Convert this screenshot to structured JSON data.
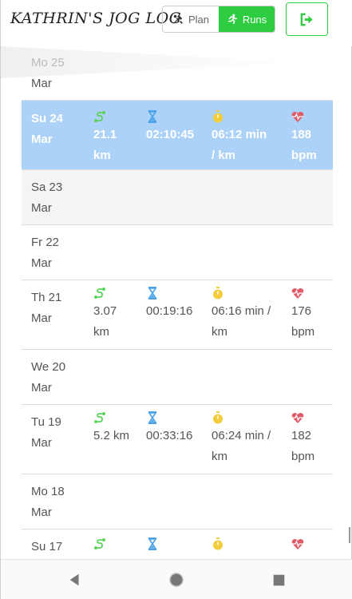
{
  "app": {
    "title": "KATHRIN'S JOG LOG"
  },
  "header": {
    "plan_label": "Plan",
    "runs_label": "Runs",
    "active_tab": "Runs"
  },
  "icons": {
    "distance": "route-icon",
    "duration": "hourglass-icon",
    "pace": "stopwatch-icon",
    "heart_rate": "heart-rate-icon",
    "logout": "sign-out-icon"
  },
  "colors": {
    "accent": "#2ecc40",
    "selected_row": "#add2f7",
    "distance_icon": "#5ed35e",
    "duration_icon": "#4aa3e8",
    "pace_icon": "#f2cc3b",
    "heart_icon": "#e05a68"
  },
  "days": [
    {
      "day": "Mo 25",
      "month": "Mar"
    },
    {
      "day": "Su 24",
      "month": "Mar",
      "distance": "21.1",
      "distance_unit": "km",
      "duration": "02:10:45",
      "pace": "06:12 min",
      "pace_unit": "/ km",
      "hr": "188",
      "hr_unit": "bpm"
    },
    {
      "day": "Sa 23",
      "month": "Mar"
    },
    {
      "day": "Fr 22",
      "month": "Mar"
    },
    {
      "day": "Th 21",
      "month": "Mar",
      "distance": "3.07",
      "distance_unit": "km",
      "duration": "00:19:16",
      "pace": "06:16 min /",
      "pace_unit": "km",
      "hr": "176",
      "hr_unit": "bpm"
    },
    {
      "day": "We 20",
      "month": "Mar"
    },
    {
      "day": "Tu 19",
      "month": "Mar",
      "distance": "5.2 km",
      "duration": "00:33:16",
      "pace": "06:24 min /",
      "pace_unit": "km",
      "hr": "182",
      "hr_unit": "bpm"
    },
    {
      "day": "Mo 18",
      "month": "Mar"
    },
    {
      "day": "Su 17"
    }
  ]
}
